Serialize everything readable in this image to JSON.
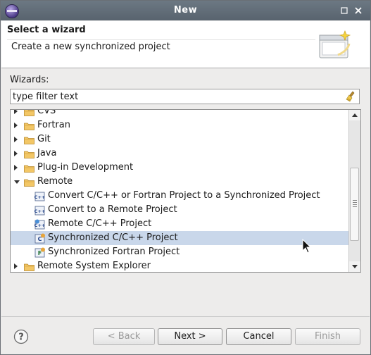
{
  "window": {
    "title": "New"
  },
  "header": {
    "title": "Select a wizard",
    "description": "Create a new synchronized project"
  },
  "wizards": {
    "label": "Wizards:",
    "filter_placeholder": "type filter text",
    "items": [
      {
        "label": "CVS",
        "kind": "folder",
        "expanded": false,
        "level": 0
      },
      {
        "label": "Fortran",
        "kind": "folder",
        "expanded": false,
        "level": 0
      },
      {
        "label": "Git",
        "kind": "folder",
        "expanded": false,
        "level": 0
      },
      {
        "label": "Java",
        "kind": "folder",
        "expanded": false,
        "level": 0
      },
      {
        "label": "Plug-in Development",
        "kind": "folder",
        "expanded": false,
        "level": 0
      },
      {
        "label": "Remote",
        "kind": "folder",
        "expanded": true,
        "level": 0
      },
      {
        "label": "Convert C/C++ or Fortran Project to a Synchronized Project",
        "kind": "wizard",
        "icon": "convert-c-project-icon",
        "level": 1
      },
      {
        "label": "Convert to a Remote Project",
        "kind": "wizard",
        "icon": "convert-c-project-icon",
        "level": 1
      },
      {
        "label": "Remote C/C++ Project",
        "kind": "wizard",
        "icon": "remote-c-project-icon",
        "level": 1
      },
      {
        "label": "Synchronized C/C++ Project",
        "kind": "wizard",
        "icon": "sync-c-project-icon",
        "level": 1,
        "selected": true
      },
      {
        "label": "Synchronized Fortran Project",
        "kind": "wizard",
        "icon": "sync-fortran-project-icon",
        "level": 1
      },
      {
        "label": "Remote System Explorer",
        "kind": "folder",
        "expanded": false,
        "level": 0
      }
    ]
  },
  "buttons": {
    "back": "< Back",
    "next": "Next >",
    "cancel": "Cancel",
    "finish": "Finish"
  },
  "colors": {
    "selection": "#c9d7ea",
    "titlebar": "#5f6a75"
  }
}
